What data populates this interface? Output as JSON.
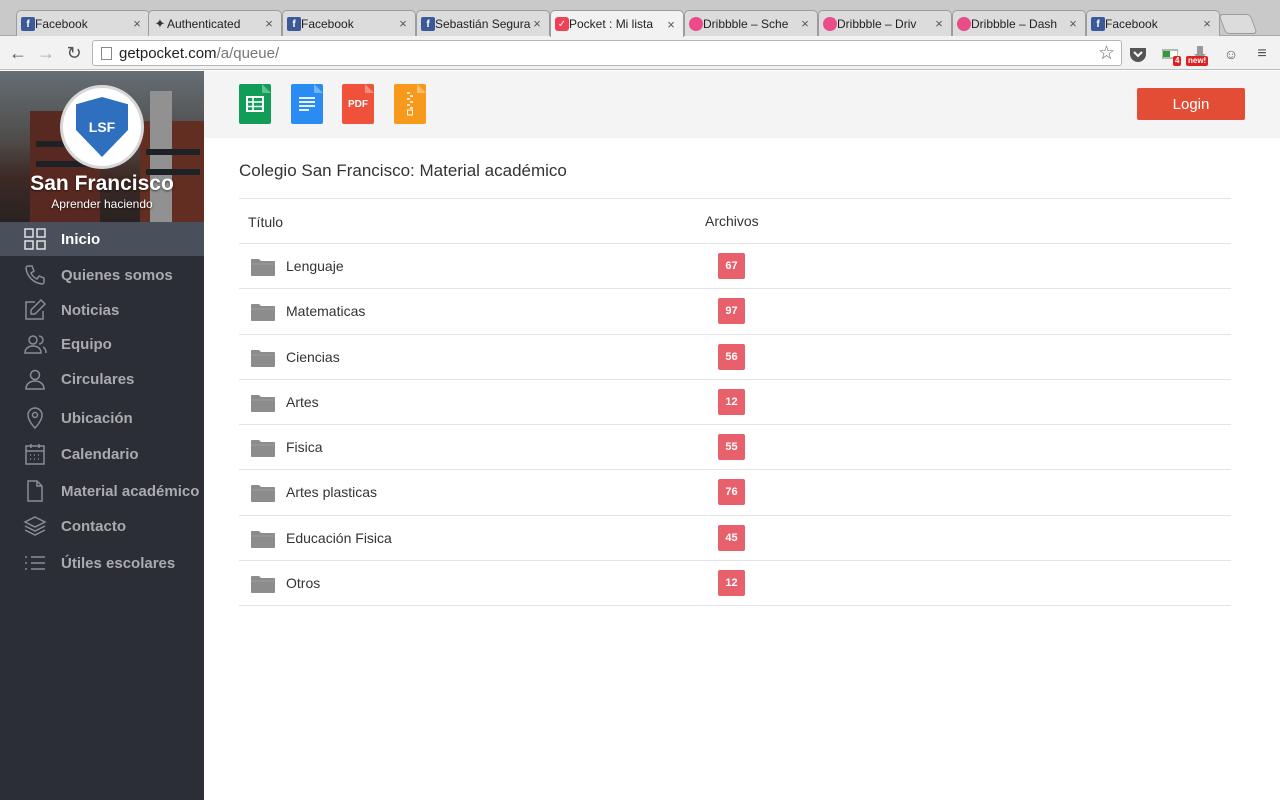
{
  "browser": {
    "tabs": [
      {
        "title": "Facebook",
        "favicon": "facebook-icon"
      },
      {
        "title": "Authenticated",
        "favicon": "authenticated-icon"
      },
      {
        "title": "Facebook",
        "favicon": "facebook-icon"
      },
      {
        "title": "Sebastián Segura",
        "favicon": "facebook-icon"
      },
      {
        "title": "Pocket : Mi lista",
        "favicon": "pocket-icon",
        "active": true
      },
      {
        "title": "Dribbble – Sche",
        "favicon": "dribbble-icon"
      },
      {
        "title": "Dribbble – Driv",
        "favicon": "dribbble-icon"
      },
      {
        "title": "Dribbble – Dash",
        "favicon": "dribbble-icon"
      },
      {
        "title": "Facebook",
        "favicon": "facebook-icon"
      }
    ],
    "url_host": "getpocket.com",
    "url_path": "/a/queue/",
    "ext_badge_count": "4",
    "ext_badge_new": "new!"
  },
  "sidebar": {
    "school_name": "San Francisco",
    "motto": "Aprender haciendo",
    "logo_text": "LSF",
    "items": [
      {
        "label": "Inicio",
        "icon": "grid-icon",
        "active": true
      },
      {
        "label": "Quienes somos",
        "icon": "phone-icon"
      },
      {
        "label": "Noticias",
        "icon": "edit-icon"
      },
      {
        "label": "Equipo",
        "icon": "team-icon"
      },
      {
        "label": "Circulares",
        "icon": "user-icon"
      },
      {
        "label": "Ubicación",
        "icon": "location-pin-icon"
      },
      {
        "label": "Calendario",
        "icon": "calendar-icon"
      },
      {
        "label": "Material académico",
        "icon": "document-icon"
      },
      {
        "label": "Contacto",
        "icon": "layers-icon"
      },
      {
        "label": "Útiles escolares",
        "icon": "list-icon"
      }
    ]
  },
  "toolbar": {
    "file_types": [
      {
        "name": "spreadsheet-file-icon",
        "color": "#0f9d58"
      },
      {
        "name": "document-file-icon",
        "color": "#2a8bf2"
      },
      {
        "name": "pdf-file-icon",
        "color": "#f0513b",
        "label": "PDF"
      },
      {
        "name": "archive-file-icon",
        "color": "#f79a1c"
      }
    ],
    "login_label": "Login"
  },
  "main": {
    "title": "Colegio San Francisco: Material académico",
    "columns": {
      "title": "Título",
      "files": "Archivos"
    },
    "rows": [
      {
        "name": "Lenguaje",
        "count": "67"
      },
      {
        "name": "Matematicas",
        "count": "97"
      },
      {
        "name": "Ciencias",
        "count": "56"
      },
      {
        "name": "Artes",
        "count": "12"
      },
      {
        "name": "Fisica",
        "count": "55"
      },
      {
        "name": "Artes plasticas",
        "count": "76"
      },
      {
        "name": "Educación Fisica",
        "count": "45"
      },
      {
        "name": "Otros",
        "count": "12"
      }
    ]
  },
  "colors": {
    "accent": "#e44d35",
    "badge": "#e8606c",
    "sidebar_bg": "#2c2e35",
    "sidebar_active": "#4a4f5c"
  }
}
